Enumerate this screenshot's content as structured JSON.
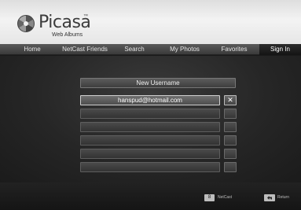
{
  "brand": {
    "name": "Picasa",
    "trademark": "™",
    "subtitle": "Web Albums"
  },
  "nav": {
    "items": [
      {
        "label": "Home"
      },
      {
        "label": "NetCast Friends"
      },
      {
        "label": "Search"
      },
      {
        "label": "My Photos"
      },
      {
        "label": "Favorites"
      },
      {
        "label": "Sign In"
      }
    ],
    "active": "Sign In"
  },
  "user_list": {
    "header_label": "New Username",
    "selected_value": "hanspud@hotmail.com",
    "delete_glyph": "✕",
    "empty_rows": 5
  },
  "footer": {
    "netcast_key": "8",
    "netcast_label": "NetCast",
    "return_icon": "return-icon",
    "return_label": "Return"
  }
}
